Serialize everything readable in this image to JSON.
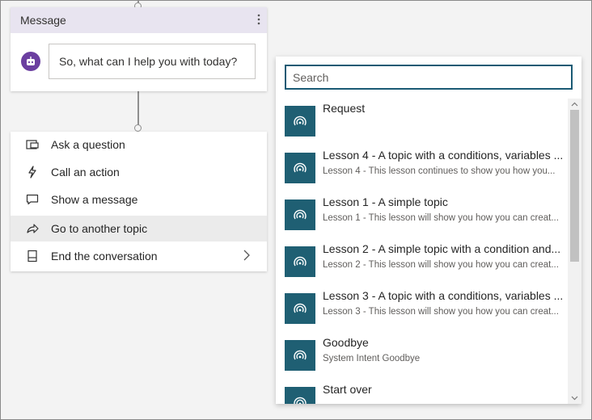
{
  "message_card": {
    "title": "Message",
    "more_icon": "more-vertical-icon",
    "bot_icon": "bot-icon",
    "text": "So, what can I help you with today?"
  },
  "actions_menu": {
    "items": [
      {
        "label": "Ask a question",
        "icon": "question-form-icon"
      },
      {
        "label": "Call an action",
        "icon": "lightning-icon"
      },
      {
        "label": "Show a message",
        "icon": "message-icon"
      },
      {
        "label": "Go to another topic",
        "icon": "redirect-arrow-icon",
        "selected": true
      },
      {
        "label": "End the conversation",
        "icon": "end-conversation-icon",
        "has_submenu": true
      }
    ]
  },
  "topic_picker": {
    "search_placeholder": "Search",
    "topics": [
      {
        "title": "Request",
        "subtitle": ""
      },
      {
        "title": "Lesson 4 - A topic with a conditions, variables ...",
        "subtitle": "Lesson 4 - This lesson continues to show you how you..."
      },
      {
        "title": "Lesson 1 - A simple topic",
        "subtitle": "Lesson 1 - This lesson will show you how you can creat..."
      },
      {
        "title": "Lesson 2 - A simple topic with a condition and...",
        "subtitle": "Lesson 2 - This lesson will show you how you can creat..."
      },
      {
        "title": "Lesson 3 - A topic with a conditions, variables ...",
        "subtitle": "Lesson 3 - This lesson will show you how you can creat..."
      },
      {
        "title": "Goodbye",
        "subtitle": "System Intent Goodbye"
      },
      {
        "title": "Start over",
        "subtitle": ""
      }
    ],
    "topic_icon": "broadcast-icon"
  },
  "colors": {
    "accent_purple": "#6b3fa0",
    "header_tint": "#e8e4f0",
    "topic_tile": "#1f5f73",
    "search_border": "#1a5a74"
  }
}
